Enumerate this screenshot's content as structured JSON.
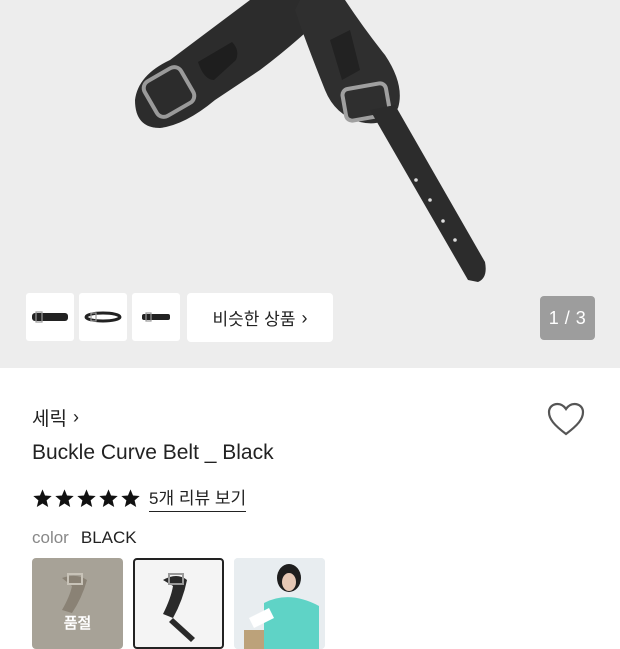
{
  "gallery": {
    "counter": "1 / 3",
    "similar_label": "비슷한 상품",
    "similar_chevron": "›",
    "thumbnails": [
      "belt-thumb-1",
      "belt-thumb-2",
      "belt-thumb-3"
    ]
  },
  "product": {
    "brand": "세릭",
    "brand_chevron": "›",
    "title": "Buckle Curve Belt _ Black",
    "rating": 5,
    "review_link": "5개 리뷰 보기",
    "color_label": "color",
    "color_value": "BLACK",
    "swatches": [
      {
        "tag": "품절",
        "state": "sold-out"
      },
      {
        "tag": "",
        "state": "selected"
      },
      {
        "tag": "",
        "state": "default"
      }
    ]
  },
  "colors": {
    "accent": "#222222",
    "hero_bg": "#ededed",
    "counter_bg": "#9d9d9d",
    "star": "#111111"
  },
  "icons": [
    "heart-icon",
    "star-icon",
    "chevron-right-icon"
  ]
}
